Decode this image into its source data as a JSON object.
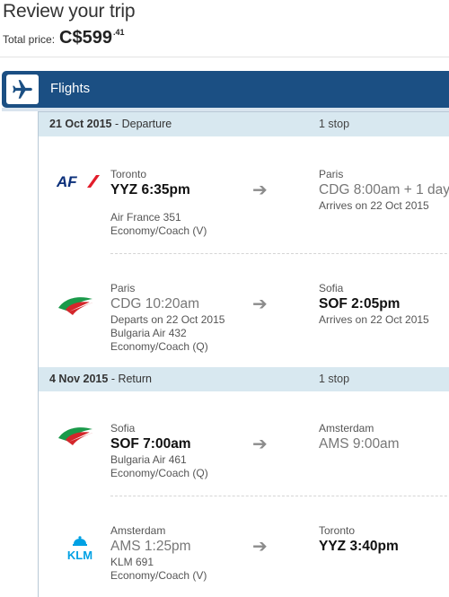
{
  "page": {
    "title": "Review your trip",
    "total_label": "Total price:",
    "total_amount": "C$599",
    "total_cents": ".41"
  },
  "section": {
    "icon": "airplane-icon",
    "label": "Flights"
  },
  "departure": {
    "date": "21 Oct 2015",
    "type": "- Departure",
    "stops": "1 stop",
    "legs": [
      {
        "airline_logo": "air-france-logo",
        "dep_city": "Toronto",
        "dep_time": "YYZ 6:35pm",
        "dep_note": "",
        "flight": "Air France 351",
        "cabin": "Economy/Coach (V)",
        "arr_city": "Paris",
        "arr_time": "CDG 8:00am + 1 day",
        "arr_note": "Arrives on 22 Oct 2015"
      },
      {
        "airline_logo": "bulgaria-air-logo",
        "dep_city": "Paris",
        "dep_time": "CDG 10:20am",
        "dep_note": "Departs on 22 Oct 2015",
        "flight": "Bulgaria Air 432",
        "cabin": "Economy/Coach (Q)",
        "arr_city": "Sofia",
        "arr_time": "SOF 2:05pm",
        "arr_note": "Arrives on 22 Oct 2015"
      }
    ]
  },
  "return": {
    "date": "4 Nov 2015",
    "type": "- Return",
    "stops": "1 stop",
    "legs": [
      {
        "airline_logo": "bulgaria-air-logo",
        "dep_city": "Sofia",
        "dep_time": "SOF 7:00am",
        "flight": "Bulgaria Air 461",
        "cabin": "Economy/Coach (Q)",
        "arr_city": "Amsterdam",
        "arr_time": "AMS 9:00am"
      },
      {
        "airline_logo": "klm-logo",
        "logo_text": "KLM",
        "dep_city": "Amsterdam",
        "dep_time": "AMS 1:25pm",
        "flight": "KLM 691",
        "cabin": "Economy/Coach (V)",
        "arr_city": "Toronto",
        "arr_time": "YYZ 3:40pm"
      }
    ]
  },
  "colors": {
    "header_bar": "#1b4f83",
    "segment_header": "#d8e8f0",
    "air_france_blue": "#0b2f7a",
    "air_france_red": "#e21d2b",
    "bulgaria_green": "#1a9a4a",
    "bulgaria_red": "#d4262b",
    "klm_blue": "#00a1e4"
  }
}
